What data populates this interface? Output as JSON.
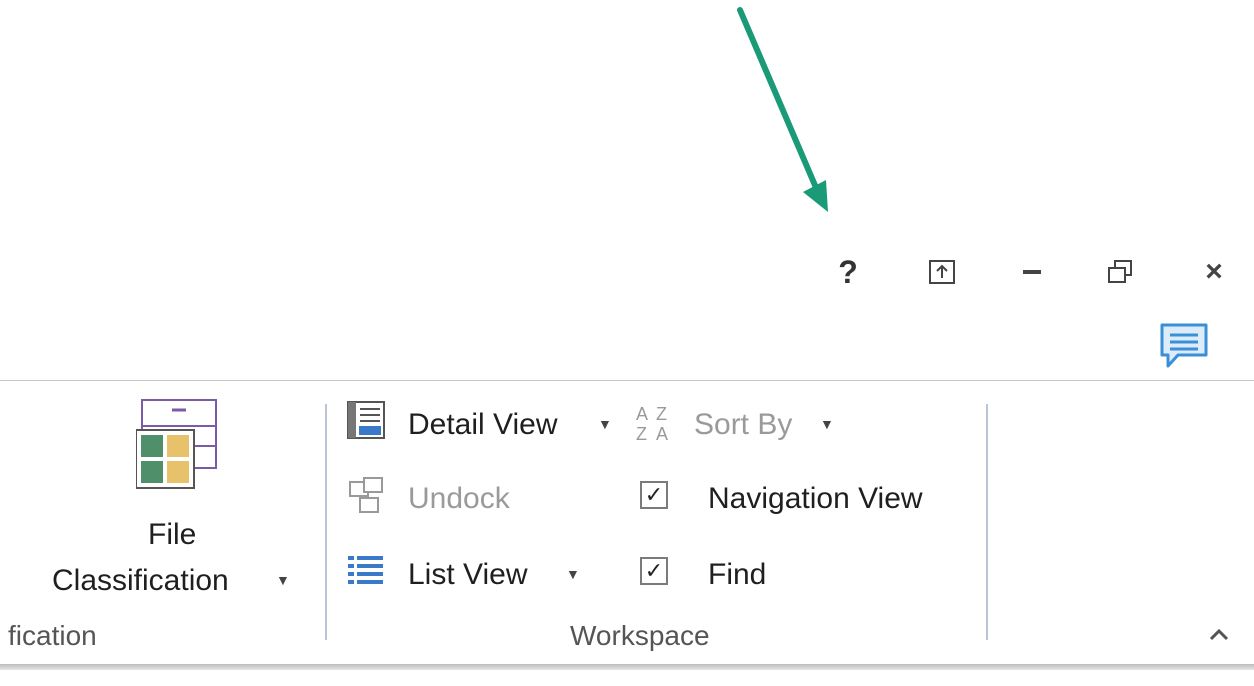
{
  "window_controls": {
    "help": "?",
    "ribbon_display_icon": "ribbon-display-options-icon",
    "minimize_icon": "minimize-icon",
    "restore_icon": "restore-icon",
    "close": "×"
  },
  "ribbon": {
    "file_classification": {
      "line1": "File",
      "line2": "Classification",
      "caret": "▼",
      "group_label": "fication"
    },
    "workspace": {
      "detail_view": "Detail View",
      "sort_by": "Sort By",
      "undock": "Undock",
      "list_view": "List View",
      "navigation_view": "Navigation View",
      "find": "Find",
      "group_label": "Workspace",
      "navigation_view_checked": true,
      "find_checked": true
    },
    "collapse": "^"
  },
  "colors": {
    "annotation_arrow": "#1a9a76",
    "comment_icon": "#3a8fd6"
  }
}
